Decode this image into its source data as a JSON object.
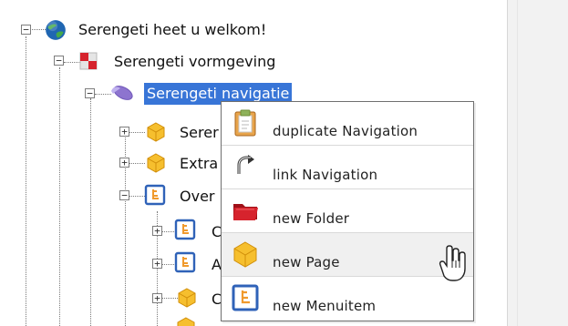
{
  "tree": {
    "root": {
      "label": "Serengeti heet u welkom!",
      "expander": "−",
      "icon": "globe-icon"
    },
    "vormgeving": {
      "label": "Serengeti vormgeving",
      "expander": "−",
      "icon": "red-white-check-icon"
    },
    "navigatie": {
      "label": "Serengeti navigatie",
      "expander": "−",
      "icon": "navigation-oval-icon"
    },
    "children": [
      {
        "label": "Serer",
        "expander": "+",
        "icon": "page-cube-icon"
      },
      {
        "label": "Extra",
        "expander": "+",
        "icon": "page-cube-icon"
      },
      {
        "label": "Over",
        "expander": "−",
        "icon": "menuitem-icon"
      },
      {
        "label": "C",
        "expander": "+",
        "icon": "menuitem-icon"
      },
      {
        "label": "A",
        "expander": "+",
        "icon": "menuitem-icon"
      },
      {
        "label": "C",
        "expander": "+",
        "icon": "page-cube-icon"
      }
    ]
  },
  "context_menu": {
    "items": [
      {
        "label": "duplicate Navigation",
        "icon": "clipboard-icon"
      },
      {
        "label": "link Navigation",
        "icon": "link-arrow-icon"
      },
      {
        "label": "new Folder",
        "icon": "folder-icon"
      },
      {
        "label": "new Page",
        "icon": "page-cube-icon"
      },
      {
        "label": "new Menuitem",
        "icon": "menuitem-icon"
      }
    ]
  },
  "colors": {
    "selection": "#3875d7",
    "menu_hover": "#f0f0f0",
    "menu_border": "#6f6f6f",
    "folder_red": "#d6232d",
    "cube_yellow": "#f6bf2e",
    "menuitem_blue": "#2f62b8"
  }
}
